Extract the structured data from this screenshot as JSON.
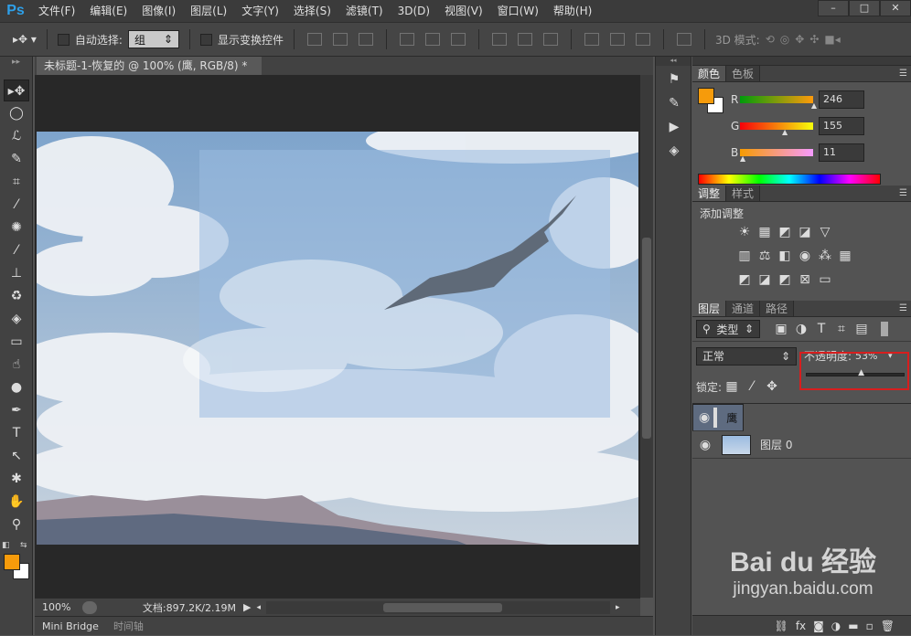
{
  "app": {
    "logo": "Ps"
  },
  "menu": [
    "文件(F)",
    "编辑(E)",
    "图像(I)",
    "图层(L)",
    "文字(Y)",
    "选择(S)",
    "滤镜(T)",
    "3D(D)",
    "视图(V)",
    "窗口(W)",
    "帮助(H)"
  ],
  "window_controls": {
    "minimize": "–",
    "maximize": "□",
    "close": "✕"
  },
  "options": {
    "auto_select_label": "自动选择:",
    "auto_select_value": "组",
    "show_transform_label": "显示变换控件",
    "mode_3d_label": "3D 模式:"
  },
  "document": {
    "tab_title": "未标题-1-恢复的 @ 100% (鹰, RGB/8) *",
    "tab_close": "×"
  },
  "status": {
    "zoom": "100%",
    "doc_info": "文档:897.2K/2.19M"
  },
  "bottom_tabs": [
    "Mini Bridge",
    "时间轴"
  ],
  "color_panel": {
    "tabs": [
      "颜色",
      "色板"
    ],
    "foreground": "#f69b0b",
    "channels": [
      {
        "label": "R",
        "value": "246"
      },
      {
        "label": "G",
        "value": "155"
      },
      {
        "label": "B",
        "value": "11"
      }
    ]
  },
  "adjust_panel": {
    "tabs": [
      "调整",
      "样式"
    ],
    "title": "添加调整"
  },
  "layers_panel": {
    "tabs": [
      "图层",
      "通道",
      "路径"
    ],
    "filter_label": "类型",
    "blend_mode": "正常",
    "opacity_label": "不透明度:",
    "opacity_value": "53%",
    "opacity_fraction": 0.53,
    "lock_label": "锁定:",
    "layers": [
      {
        "name": "鹰",
        "selected": true
      },
      {
        "name": "图层 0",
        "selected": false
      }
    ]
  },
  "watermark": {
    "brand": "Bai du 经验",
    "url": "jingyan.baidu.com"
  }
}
